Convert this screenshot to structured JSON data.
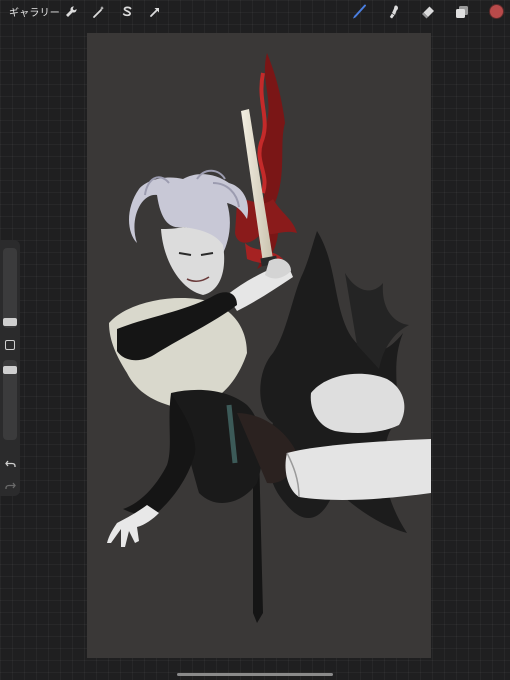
{
  "topbar": {
    "gallery_label": "ギャラリー",
    "left_tools": [
      "wrench-icon",
      "magic-wand-icon",
      "selection-icon",
      "transform-arrow-icon"
    ],
    "right_tools": [
      "brush-icon",
      "smudge-icon",
      "eraser-icon",
      "layers-icon"
    ],
    "active_tool": "brush-icon",
    "accent_color": "#4a7ee0",
    "current_color": "#b84a4a"
  },
  "sidebar": {
    "controls": [
      "brush-size-slider",
      "modify-button",
      "opacity-slider",
      "undo-icon",
      "redo-icon"
    ]
  },
  "canvas": {
    "background": "#3a3837"
  }
}
